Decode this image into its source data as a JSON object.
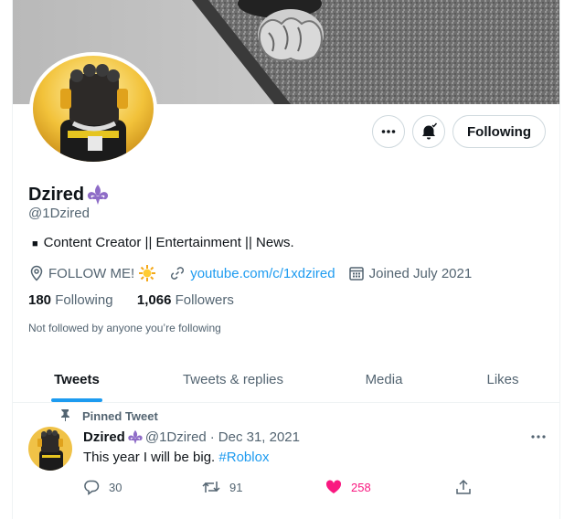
{
  "profile": {
    "name": "Dzired",
    "handle": "@1Dzired",
    "bio_prefix": "■",
    "bio": "Content Creator || Entertainment || News.",
    "location": "FOLLOW ME!",
    "website": "youtube.com/c/1xdzired",
    "joined": "Joined July 2021",
    "following_count": "180",
    "following_label": "Following",
    "followers_count": "1,066",
    "followers_label": "Followers",
    "not_followed": "Not followed by anyone you’re following"
  },
  "actions": {
    "follow_label": "Following"
  },
  "tabs": [
    {
      "label": "Tweets"
    },
    {
      "label": "Tweets & replies"
    },
    {
      "label": "Media"
    },
    {
      "label": "Likes"
    }
  ],
  "tweet": {
    "pinned_label": "Pinned Tweet",
    "name": "Dzired",
    "handle": "@1Dzired",
    "separator": "·",
    "date": "Dec 31, 2021",
    "text": "This year I will be big.",
    "hashtag": "#Roblox",
    "replies": "30",
    "retweets": "91",
    "likes": "258"
  },
  "colors": {
    "accent": "#1d9bf0",
    "like": "#f91880",
    "fleur": "#8e6cc7"
  },
  "icons": [
    "more-icon",
    "bell-icon",
    "location-icon",
    "sun-emoji-icon",
    "link-icon",
    "calendar-icon",
    "pin-icon",
    "reply-icon",
    "retweet-icon",
    "heart-icon",
    "share-icon",
    "fleur-de-lis-icon"
  ]
}
